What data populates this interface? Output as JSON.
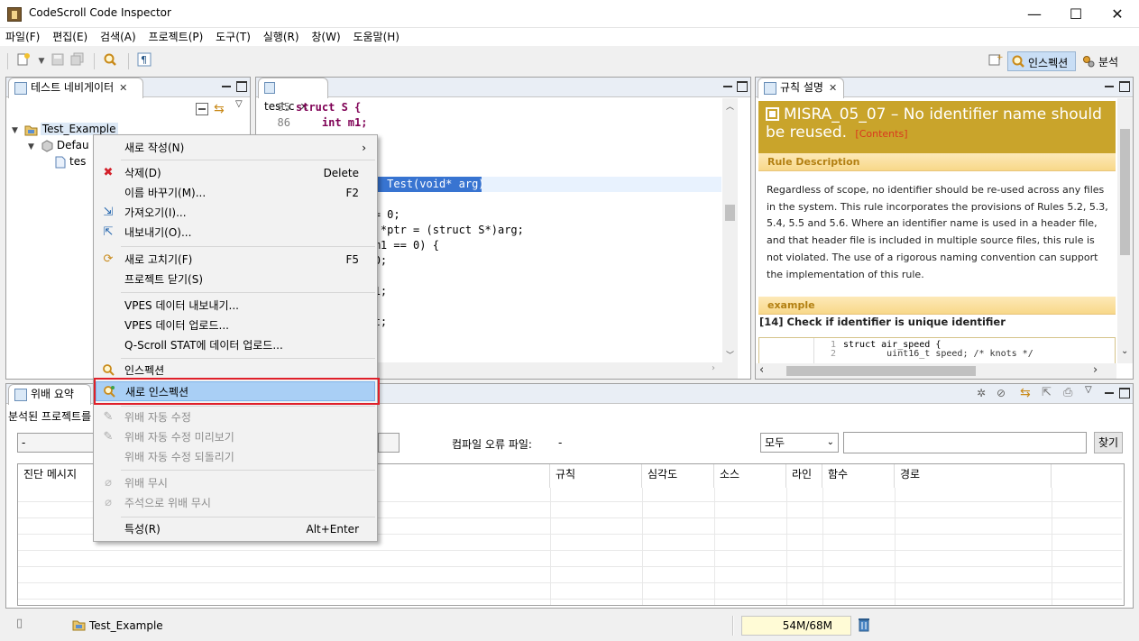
{
  "window": {
    "title": "CodeScroll Code Inspector",
    "controls": {
      "minimize": "—",
      "maximize": "☐",
      "close": "✕"
    }
  },
  "menubar": [
    "파일(F)",
    "편집(E)",
    "검색(A)",
    "프로젝트(P)",
    "도구(T)",
    "실행(R)",
    "창(W)",
    "도움말(H)"
  ],
  "perspectives": {
    "inspection": "인스펙션",
    "analysis": "분석"
  },
  "navigator": {
    "tab_label": "테스트 네비게이터",
    "tree": {
      "project": "Test_Example",
      "package": "Defau",
      "file": "tes"
    }
  },
  "editor": {
    "tab_label": "test.c",
    "lines": [
      {
        "no": "85",
        "code": "struct S {"
      },
      {
        "no": "86",
        "code": "    int m1;"
      },
      {
        "no": "",
        "code": "    "
      },
      {
        "no": "",
        "code": ""
      },
      {
        "no": "",
        "code": ""
      },
      {
        "no": "",
        "code": "              Test(void* arg)"
      },
      {
        "no": "",
        "code": ""
      },
      {
        "no": "",
        "code": "            = 0;"
      },
      {
        "no": "",
        "code": "             *ptr = (struct S*)arg;"
      },
      {
        "no": "",
        "code": "            m1 == 0) {"
      },
      {
        "no": "",
        "code": "            0;"
      },
      {
        "no": "",
        "code": ""
      },
      {
        "no": "",
        "code": "            1;"
      },
      {
        "no": "",
        "code": ""
      },
      {
        "no": "",
        "code": "            t;"
      }
    ]
  },
  "rule": {
    "tab_label": "규칙 설명",
    "title": "MISRA_05_07 – No identifier name should be reused.",
    "contents_link": "[Contents]",
    "section_description": "Rule Description",
    "description": "Regardless of scope, no identifier should be re-used across any files in the system. This rule incorporates the provisions of Rules 5.2, 5.3, 5.4, 5.5 and 5.6. Where an identifier name is used in a header file, and that header file is included in multiple source files, this rule is not violated. The use of a rigorous naming convention can support the implementation of this rule.",
    "section_example": "example",
    "example_heading": "[14] Check if identifier is unique identifier",
    "example_code": [
      {
        "no": "1",
        "code": "struct air_speed {"
      },
      {
        "no": "2",
        "code": "        uint16_t speed; /* knots */"
      }
    ]
  },
  "context_menu": {
    "items": [
      {
        "label": "새로 작성(N)",
        "shortcut": "",
        "submenu": true,
        "disabled": false,
        "icon": ""
      },
      {
        "label": "삭제(D)",
        "shortcut": "Delete",
        "disabled": false,
        "icon": "✖"
      },
      {
        "label": "이름 바꾸기(M)...",
        "shortcut": "F2",
        "disabled": false,
        "icon": ""
      },
      {
        "label": "가져오기(I)...",
        "shortcut": "",
        "disabled": false,
        "icon": "⇲"
      },
      {
        "label": "내보내기(O)...",
        "shortcut": "",
        "disabled": false,
        "icon": "⇱"
      },
      {
        "label": "새로 고치기(F)",
        "shortcut": "F5",
        "disabled": false,
        "icon": "⟳"
      },
      {
        "label": "프로젝트 닫기(S)",
        "shortcut": "",
        "disabled": false,
        "icon": ""
      },
      {
        "label": "VPES 데이터 내보내기...",
        "shortcut": "",
        "disabled": false,
        "icon": ""
      },
      {
        "label": "VPES 데이터 업로드...",
        "shortcut": "",
        "disabled": false,
        "icon": ""
      },
      {
        "label": "Q-Scroll STAT에 데이터 업로드...",
        "shortcut": "",
        "disabled": false,
        "icon": ""
      },
      {
        "label": "인스펙션",
        "shortcut": "",
        "disabled": false,
        "icon": "🔍"
      },
      {
        "label": "새로 인스펙션",
        "shortcut": "",
        "disabled": false,
        "icon": "🔍"
      },
      {
        "label": "위배 자동 수정",
        "shortcut": "",
        "disabled": true,
        "icon": ""
      },
      {
        "label": "위배 자동 수정 미리보기",
        "shortcut": "",
        "disabled": true,
        "icon": ""
      },
      {
        "label": "위배 자동 수정 되돌리기",
        "shortcut": "",
        "disabled": true,
        "icon": ""
      },
      {
        "label": "위배 무시",
        "shortcut": "",
        "disabled": true,
        "icon": ""
      },
      {
        "label": "주석으로 위배 무시",
        "shortcut": "",
        "disabled": true,
        "icon": ""
      },
      {
        "label": "특성(R)",
        "shortcut": "Alt+Enter",
        "disabled": false,
        "icon": ""
      }
    ]
  },
  "bottom": {
    "tab_label": "위배 요약",
    "analyzed_label": "분석된 프로젝트를",
    "field_value": "-",
    "compile_error_label": "컴파일 오류 파일:",
    "compile_error_value": "-",
    "filter_selected": "모두",
    "search_placeholder": "",
    "find_button": "찾기",
    "columns": [
      "진단 메시지",
      "규칙",
      "심각도",
      "소스",
      "라인",
      "함수",
      "경로"
    ]
  },
  "status": {
    "project": "Test_Example",
    "memory": "54M/68M"
  },
  "colors": {
    "accent": "#c9a42b",
    "selection": "#a9cff5",
    "highlight_border": "#e0202a"
  }
}
